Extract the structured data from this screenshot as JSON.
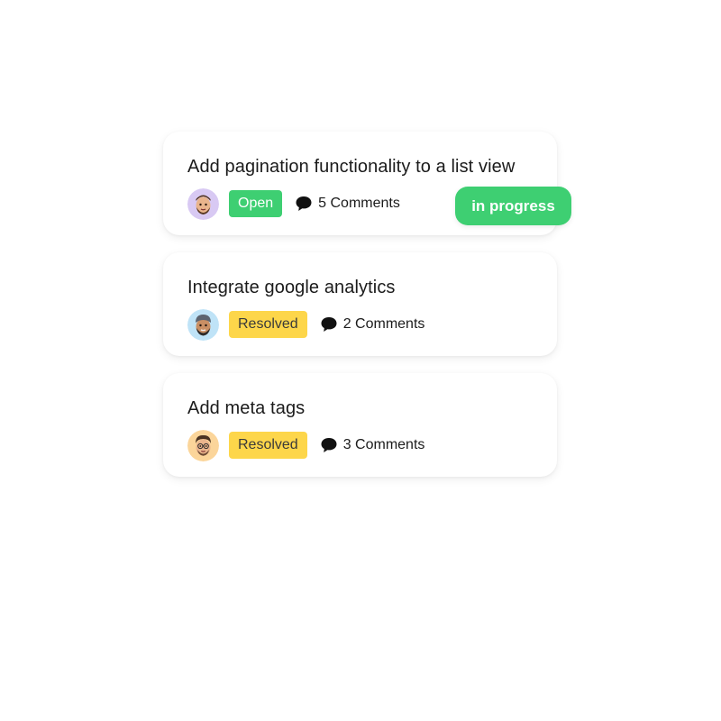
{
  "tasks": [
    {
      "title": "Add pagination functionality to a list view",
      "status": "Open",
      "comments": "5 Comments",
      "avatar_icon": "avatar-man-beard-purple",
      "status_color": "#3ecf72"
    },
    {
      "title": "Integrate google analytics",
      "status": "Resolved",
      "comments": "2 Comments",
      "avatar_icon": "avatar-man-cap-blue",
      "status_color": "#fdd64a"
    },
    {
      "title": "Add meta tags",
      "status": "Resolved",
      "comments": "3 Comments",
      "avatar_icon": "avatar-man-glasses-orange",
      "status_color": "#fdd64a"
    }
  ],
  "drag_pill": {
    "label": "in progress",
    "color": "#3ecf72"
  },
  "icons": {
    "comment": "speech-bubble-icon"
  }
}
